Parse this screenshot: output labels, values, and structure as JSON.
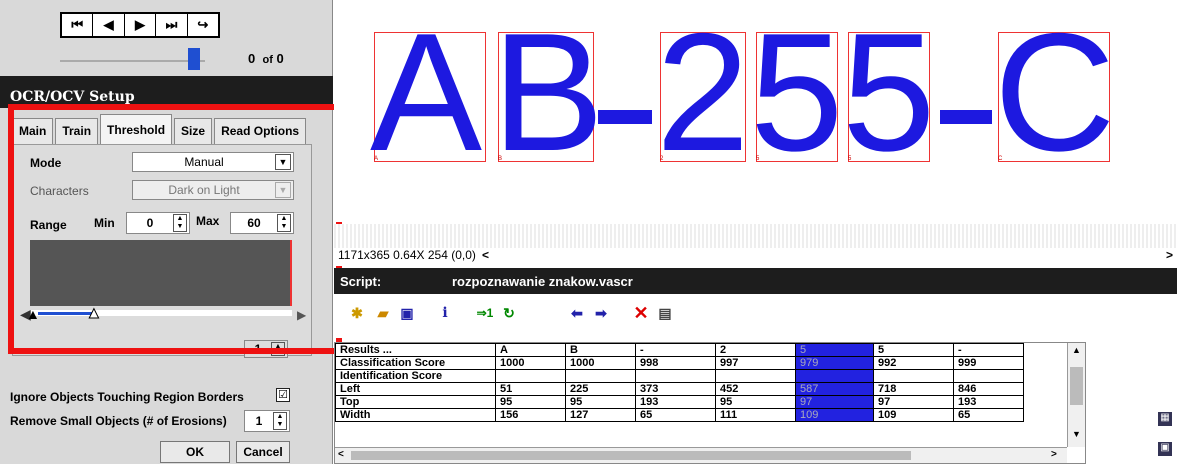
{
  "nav": {
    "counter_value": "0",
    "counter_of": "of",
    "counter_total": "0"
  },
  "setup": {
    "title": "OCR/OCV Setup",
    "tabs": [
      "Main",
      "Train",
      "Threshold",
      "Size",
      "Read Options"
    ],
    "mode_label": "Mode",
    "mode_value": "Manual",
    "characters_label": "Characters",
    "characters_value": "Dark on Light",
    "range_label": "Range",
    "min_label": "Min",
    "min_value": "0",
    "max_label": "Max",
    "max_value": "60",
    "hidden_value": "1",
    "ignore_label": "Ignore Objects Touching Region Borders",
    "ignore_checked": "☑",
    "remove_label": "Remove Small Objects (# of Erosions)",
    "remove_value": "1",
    "ok_label": "OK",
    "cancel_label": "Cancel"
  },
  "image": {
    "characters": [
      "A",
      "B",
      "-",
      "2",
      "5",
      "5",
      "-",
      "C"
    ],
    "labels": [
      "A",
      "B",
      "2",
      "5",
      "5",
      "C"
    ]
  },
  "status": {
    "text": "1171x365 0.64X 254   (0,0)"
  },
  "script": {
    "label": "Script:",
    "name": "rozpoznawanie znakow.vascr"
  },
  "results": {
    "header": [
      "Results ...",
      "A",
      "B",
      "-",
      "2",
      "5",
      "5",
      "-"
    ],
    "rows": [
      [
        "Classification Score",
        "1000",
        "1000",
        "998",
        "997",
        "979",
        "992",
        "999"
      ],
      [
        "Identification Score",
        "",
        "",
        "",
        "",
        "",
        "",
        ""
      ],
      [
        "Left",
        "51",
        "225",
        "373",
        "452",
        "587",
        "718",
        "846"
      ],
      [
        "Top",
        "95",
        "95",
        "193",
        "95",
        "97",
        "97",
        "193"
      ],
      [
        "Width",
        "156",
        "127",
        "65",
        "111",
        "109",
        "109",
        "65"
      ]
    ],
    "highlight_col": 5
  },
  "colors": {
    "accent_blue": "#1d19e0",
    "frame_red": "#ee1111",
    "titlebar": "#1d1d1d"
  },
  "icons": [
    "first-icon",
    "prev-icon",
    "play-icon",
    "last-icon",
    "loop-icon",
    "new-icon",
    "open-icon",
    "save-icon",
    "info-icon",
    "step-icon",
    "refresh-icon",
    "back-icon",
    "forward-icon",
    "delete-icon",
    "properties-icon"
  ]
}
